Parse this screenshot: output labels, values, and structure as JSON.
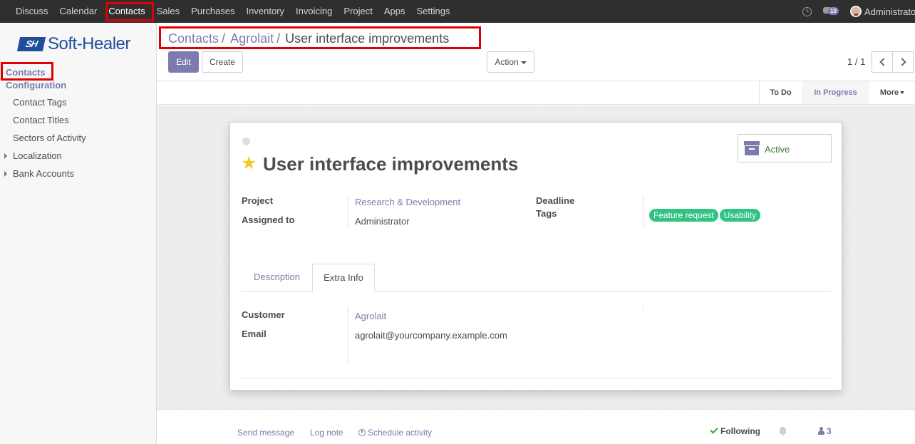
{
  "navbar": {
    "menu": [
      "Discuss",
      "Calendar",
      "Contacts",
      "Sales",
      "Purchases",
      "Inventory",
      "Invoicing",
      "Project",
      "Apps",
      "Settings"
    ],
    "active": "Contacts",
    "message_count": "10",
    "user_name": "Administrator"
  },
  "sidebar": {
    "logo_mark": "SH",
    "logo_text": "Soft‑Healer",
    "sections": [
      "Contacts",
      "Configuration"
    ],
    "items": [
      "Contact Tags",
      "Contact Titles",
      "Sectors of Activity",
      "Localization",
      "Bank Accounts"
    ]
  },
  "breadcrumb": {
    "items": [
      "Contacts",
      "Agrolait"
    ],
    "current": "User interface improvements",
    "separator": "/"
  },
  "toolbar": {
    "edit_label": "Edit",
    "create_label": "Create",
    "action_label": "Action",
    "pager": "1 / 1"
  },
  "statusbar": {
    "stages": [
      "To Do",
      "In Progress"
    ],
    "current_stage": "In Progress",
    "more_label": "More"
  },
  "form": {
    "title": "User interface improvements",
    "priority_starred": true,
    "active_label": "Active",
    "project_label": "Project",
    "project_value": "Research & Development",
    "assigned_label": "Assigned to",
    "assigned_value": "Administrator",
    "deadline_label": "Deadline",
    "deadline_value": "",
    "tags_label": "Tags",
    "tags": [
      "Feature request",
      "Usability"
    ],
    "tabs": [
      "Description",
      "Extra Info"
    ],
    "active_tab": "Extra Info",
    "customer_label": "Customer",
    "customer_value": "Agrolait",
    "email_label": "Email",
    "email_value": "agrolait@yourcompany.example.com"
  },
  "chatter": {
    "send_message": "Send message",
    "log_note": "Log note",
    "schedule_activity": "Schedule activity",
    "following": "Following",
    "followers": "3"
  },
  "colors": {
    "brand": "#7c7bad",
    "navbar": "#2f2f2f",
    "tag": "#30c381",
    "highlight": "#e00000"
  }
}
